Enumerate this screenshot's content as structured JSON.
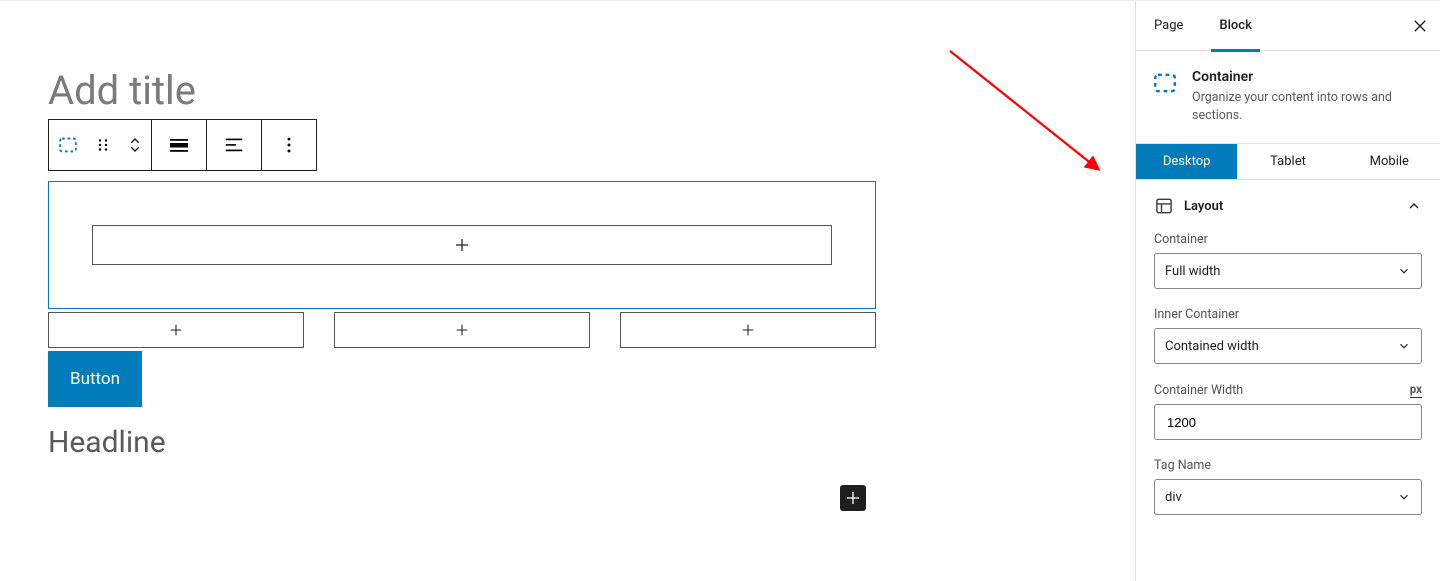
{
  "editor": {
    "title_placeholder": "Add title",
    "toolbar": {
      "selection": "container",
      "drag": "drag",
      "move": "move-up-down",
      "align_full": "align-full",
      "align_left": "align-left",
      "more": "more"
    },
    "inner_plus": "+",
    "col_plus": [
      "+",
      "+",
      "+"
    ],
    "button_label": "Button",
    "headline_text": "Headline",
    "fab_plus": "+"
  },
  "sidebar": {
    "tabs": {
      "page": "Page",
      "block": "Block"
    },
    "card": {
      "title": "Container",
      "desc": "Organize your content into rows and sections."
    },
    "devices": {
      "desktop": "Desktop",
      "tablet": "Tablet",
      "mobile": "Mobile"
    },
    "layout_panel": {
      "title": "Layout",
      "container_label": "Container",
      "container_value": "Full width",
      "inner_label": "Inner Container",
      "inner_value": "Contained width",
      "width_label": "Container Width",
      "width_unit": "px",
      "width_value": "1200",
      "tag_label": "Tag Name",
      "tag_value": "div"
    }
  }
}
